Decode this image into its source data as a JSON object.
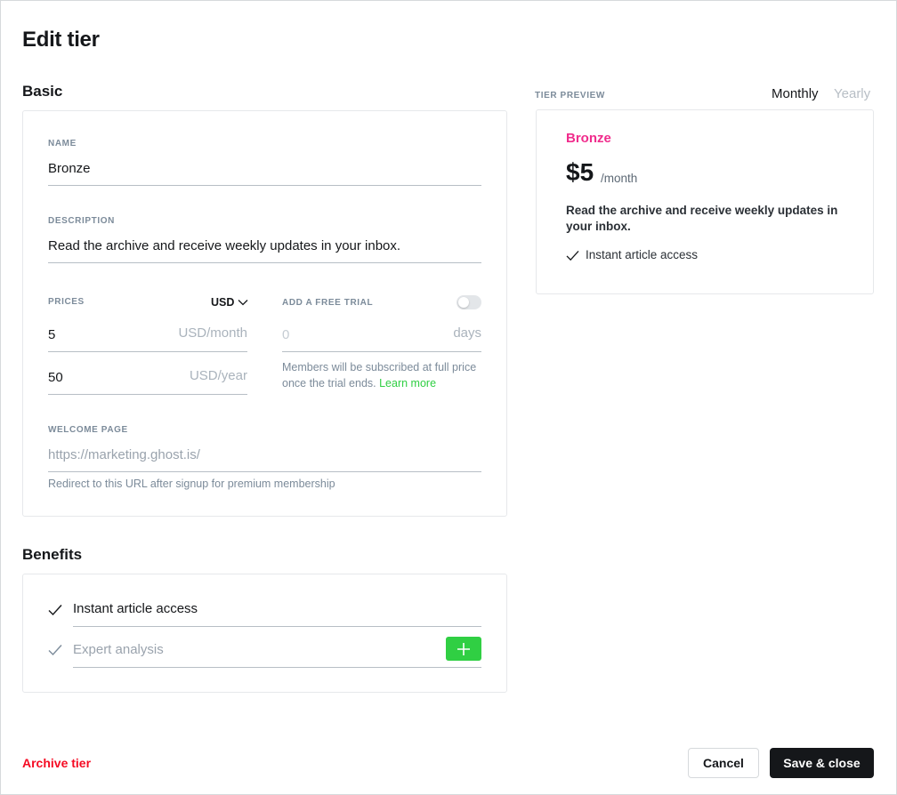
{
  "page": {
    "title": "Edit tier"
  },
  "basic": {
    "heading": "Basic",
    "name": {
      "label": "NAME",
      "value": "Bronze"
    },
    "description": {
      "label": "DESCRIPTION",
      "value": "Read the archive and receive weekly updates in your inbox."
    },
    "prices": {
      "label": "PRICES",
      "currency": "USD",
      "monthly_value": "5",
      "monthly_unit": "USD/month",
      "yearly_value": "50",
      "yearly_unit": "USD/year"
    },
    "trial": {
      "label": "ADD A FREE TRIAL",
      "enabled": false,
      "value_placeholder": "0",
      "unit": "days",
      "hint": "Members will be subscribed at full price once the trial ends.",
      "learn_more": "Learn more"
    },
    "welcome_page": {
      "label": "WELCOME PAGE",
      "placeholder": "https://marketing.ghost.is/",
      "hint": "Redirect to this URL after signup for premium membership"
    }
  },
  "benefits": {
    "heading": "Benefits",
    "items": [
      {
        "label": "Instant article access"
      }
    ],
    "new_placeholder": "Expert analysis"
  },
  "preview": {
    "label": "TIER PREVIEW",
    "period_monthly": "Monthly",
    "period_yearly": "Yearly",
    "selected_period": "Monthly",
    "tier_name": "Bronze",
    "price": "$5",
    "price_period": "/month",
    "description": "Read the archive and receive weekly updates in your inbox.",
    "benefits": [
      "Instant article access"
    ]
  },
  "footer": {
    "archive_label": "Archive tier",
    "cancel_label": "Cancel",
    "save_label": "Save & close"
  },
  "colors": {
    "accent_green": "#30cf43",
    "tier_pink": "#f02c8c",
    "danger_red": "#f50b23",
    "dark": "#15171a"
  },
  "icons": {
    "check": "check-icon",
    "chevron": "chevron-down-icon",
    "plus": "plus-icon"
  }
}
